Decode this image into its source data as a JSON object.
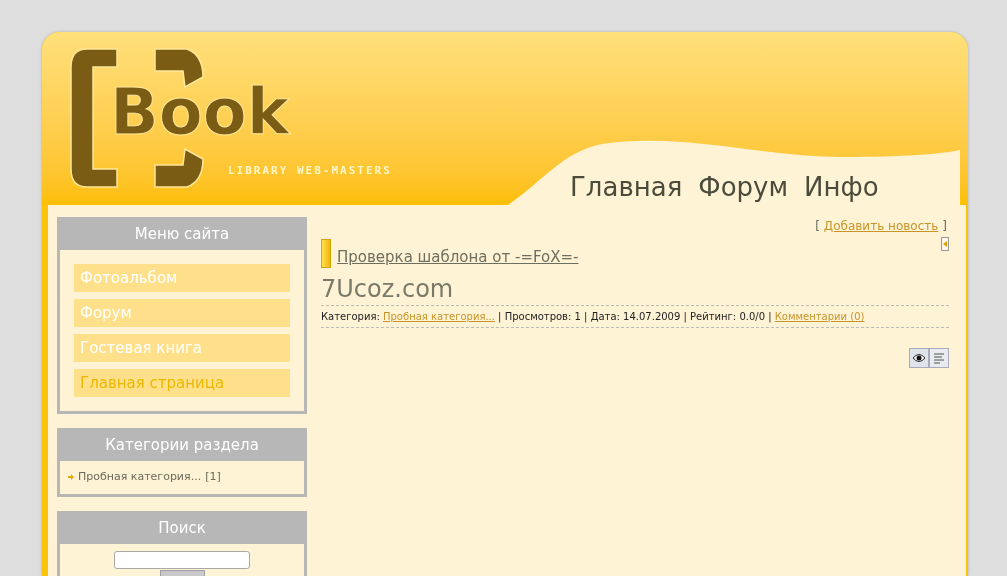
{
  "header": {
    "logo": "Book",
    "tagline": "LIBRARY WEB-MASTERS",
    "nav": [
      "Главная",
      "Форум",
      "Инфо"
    ]
  },
  "site_menu": {
    "title": "Меню сайта",
    "items": [
      {
        "label": "Фотоальбом",
        "selected": false
      },
      {
        "label": "Форум",
        "selected": false
      },
      {
        "label": "Гостевая книга",
        "selected": false
      },
      {
        "label": "Главная страница",
        "selected": true
      }
    ]
  },
  "categories": {
    "title": "Категории раздела",
    "items": [
      {
        "label": "Пробная категория...",
        "count": "[1]"
      }
    ]
  },
  "search": {
    "title": "Поиск"
  },
  "add_news": {
    "open": "[",
    "label": "Добавить новость",
    "close": "]"
  },
  "post": {
    "title": "Проверка шаблона от -=FoX=-",
    "body": "7Ucoz.com",
    "meta": [
      {
        "kind": "text",
        "text": "Категория: "
      },
      {
        "kind": "link",
        "text": "Пробная категория..."
      },
      {
        "kind": "text",
        "text": " | Просмотров: 1 | Дата: 14.07.2009 | Рейтинг: 0.0/0 | "
      },
      {
        "kind": "link",
        "text": "Комментарии (0)"
      }
    ]
  }
}
